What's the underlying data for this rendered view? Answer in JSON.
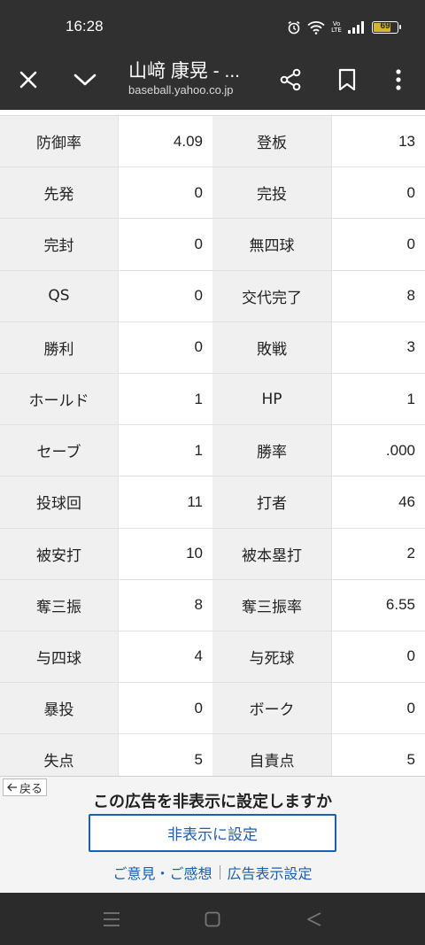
{
  "status_bar": {
    "time": "16:28",
    "volte_label": "Vo LTE",
    "battery_level": "69",
    "icons": [
      "alarm-icon",
      "wifi-icon",
      "volte-icon",
      "signal-icon",
      "battery-icon"
    ]
  },
  "toolbar": {
    "title": "山﨑 康晃 - ...",
    "url": "baseball.yahoo.co.jp",
    "icons": [
      "close-icon",
      "chevron-down-icon",
      "share-icon",
      "bookmark-icon",
      "more-vert-icon"
    ]
  },
  "stats": [
    {
      "l1": "防御率",
      "v1": "4.09",
      "l2": "登板",
      "v2": "13"
    },
    {
      "l1": "先発",
      "v1": "0",
      "l2": "完投",
      "v2": "0"
    },
    {
      "l1": "完封",
      "v1": "0",
      "l2": "無四球",
      "v2": "0"
    },
    {
      "l1": "QS",
      "v1": "0",
      "l2": "交代完了",
      "v2": "8"
    },
    {
      "l1": "勝利",
      "v1": "0",
      "l2": "敗戦",
      "v2": "3"
    },
    {
      "l1": "ホールド",
      "v1": "1",
      "l2": "HP",
      "v2": "1"
    },
    {
      "l1": "セーブ",
      "v1": "1",
      "l2": "勝率",
      "v2": ".000"
    },
    {
      "l1": "投球回",
      "v1": "11",
      "l2": "打者",
      "v2": "46"
    },
    {
      "l1": "被安打",
      "v1": "10",
      "l2": "被本塁打",
      "v2": "2"
    },
    {
      "l1": "奪三振",
      "v1": "8",
      "l2": "奪三振率",
      "v2": "6.55"
    },
    {
      "l1": "与四球",
      "v1": "4",
      "l2": "与死球",
      "v2": "0"
    },
    {
      "l1": "暴投",
      "v1": "0",
      "l2": "ボーク",
      "v2": "0"
    },
    {
      "l1": "失点",
      "v1": "5",
      "l2": "自責点",
      "v2": "5"
    }
  ],
  "ad_panel": {
    "back_label": "戻る",
    "title": "この広告を非表示に設定しますか",
    "hide_button": "非表示に設定",
    "feedback_link": "ご意見・ご感想",
    "settings_link": "広告表示設定"
  },
  "nav_bar": {
    "icons": [
      "recent-apps-icon",
      "home-icon",
      "back-icon"
    ]
  },
  "colors": {
    "chrome_dark": "#303030",
    "label_cell_bg": "#f0f0f0",
    "link_blue": "#1a5fb4",
    "battery_fill": "#d4b52a"
  }
}
